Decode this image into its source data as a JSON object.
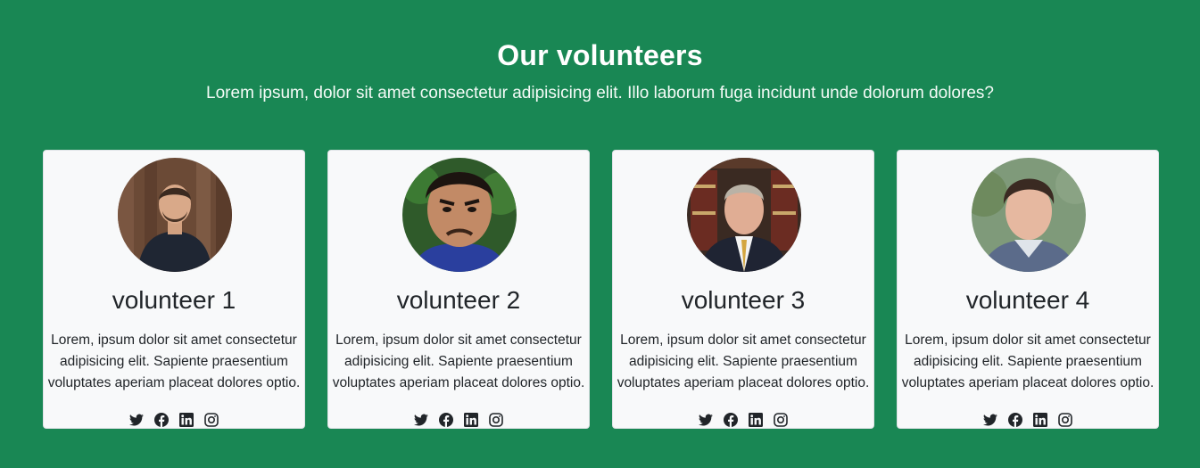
{
  "section": {
    "title": "Our volunteers",
    "subtitle": "Lorem ipsum, dolor sit amet consectetur adipisicing elit. Illo laborum fuga incidunt unde dolorum dolores?"
  },
  "volunteers": [
    {
      "name": "volunteer 1",
      "bio_lines": [
        "Lorem, ipsum dolor sit amet consectetur",
        "adipisicing elit. Sapiente praesentium",
        "voluptates aperiam placeat dolores optio."
      ]
    },
    {
      "name": "volunteer 2",
      "bio_lines": [
        "Lorem, ipsum dolor sit amet consectetur",
        "adipisicing elit. Sapiente praesentium",
        "voluptates aperiam placeat dolores optio."
      ]
    },
    {
      "name": "volunteer 3",
      "bio_lines": [
        "Lorem, ipsum dolor sit amet consectetur",
        "adipisicing elit. Sapiente praesentium",
        "voluptates aperiam placeat dolores optio."
      ]
    },
    {
      "name": "volunteer 4",
      "bio_lines": [
        "Lorem, ipsum dolor sit amet consectetur",
        "adipisicing elit. Sapiente praesentium",
        "voluptates aperiam placeat dolores optio."
      ]
    }
  ],
  "social_icons": [
    "twitter-icon",
    "facebook-icon",
    "linkedin-icon",
    "instagram-icon"
  ],
  "colors": {
    "background": "#198754",
    "card": "#f8f9fa",
    "text": "#212529"
  }
}
